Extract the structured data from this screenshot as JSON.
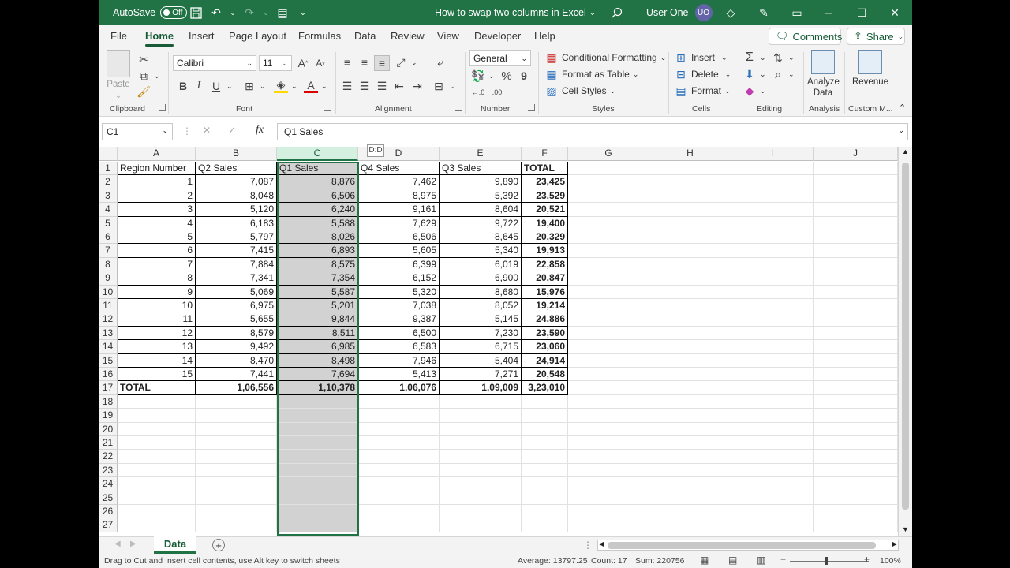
{
  "titlebar": {
    "autosave_label": "AutoSave",
    "autosave_state": "Off",
    "doc_title": "How to swap two columns in Excel",
    "user_name": "User One",
    "user_initials": "UO"
  },
  "tabs": [
    "File",
    "Home",
    "Insert",
    "Page Layout",
    "Formulas",
    "Data",
    "Review",
    "View",
    "Developer",
    "Help"
  ],
  "active_tab": "Home",
  "comments_label": "Comments",
  "share_label": "Share",
  "ribbon": {
    "clipboard": {
      "paste_label": "Paste",
      "group_label": "Clipboard"
    },
    "font": {
      "font_name": "Calibri",
      "font_size": "11",
      "group_label": "Font"
    },
    "alignment": {
      "group_label": "Alignment"
    },
    "number": {
      "format": "General",
      "group_label": "Number",
      "percent": "%",
      "comma": "9",
      "inc_decimal": "←.0\n.00",
      "dec_decimal": ".00\n→.0"
    },
    "styles": {
      "conditional": "Conditional Formatting",
      "format_table": "Format as Table",
      "cell_styles": "Cell Styles",
      "group_label": "Styles"
    },
    "cells": {
      "insert": "Insert",
      "delete": "Delete",
      "format": "Format",
      "group_label": "Cells"
    },
    "editing": {
      "group_label": "Editing"
    },
    "analysis": {
      "button": "Analyze Data",
      "group_label": "Analysis"
    },
    "custom": {
      "button": "Revenue",
      "group_label": "Custom M..."
    }
  },
  "namebox": "C1",
  "formula": "Q1 Sales",
  "drag_tip": "D:D",
  "columns": [
    "A",
    "B",
    "C",
    "D",
    "E",
    "F",
    "G",
    "H",
    "I",
    "J"
  ],
  "selected_column": "C",
  "headers": [
    "Region Number",
    "Q2 Sales",
    "Q1 Sales",
    "Q4 Sales",
    "Q3 Sales",
    "TOTAL"
  ],
  "rows": [
    [
      "1",
      "7,087",
      "8,876",
      "7,462",
      "9,890",
      "23,425"
    ],
    [
      "2",
      "8,048",
      "6,506",
      "8,975",
      "5,392",
      "23,529"
    ],
    [
      "3",
      "5,120",
      "6,240",
      "9,161",
      "8,604",
      "20,521"
    ],
    [
      "4",
      "6,183",
      "5,588",
      "7,629",
      "9,722",
      "19,400"
    ],
    [
      "5",
      "5,797",
      "8,026",
      "6,506",
      "8,645",
      "20,329"
    ],
    [
      "6",
      "7,415",
      "6,893",
      "5,605",
      "5,340",
      "19,913"
    ],
    [
      "7",
      "7,884",
      "8,575",
      "6,399",
      "6,019",
      "22,858"
    ],
    [
      "8",
      "7,341",
      "7,354",
      "6,152",
      "6,900",
      "20,847"
    ],
    [
      "9",
      "5,069",
      "5,587",
      "5,320",
      "8,680",
      "15,976"
    ],
    [
      "10",
      "6,975",
      "5,201",
      "7,038",
      "8,052",
      "19,214"
    ],
    [
      "11",
      "5,655",
      "9,844",
      "9,387",
      "5,145",
      "24,886"
    ],
    [
      "12",
      "8,579",
      "8,511",
      "6,500",
      "7,230",
      "23,590"
    ],
    [
      "13",
      "9,492",
      "6,985",
      "6,583",
      "6,715",
      "23,060"
    ],
    [
      "14",
      "8,470",
      "8,498",
      "7,946",
      "5,404",
      "24,914"
    ],
    [
      "15",
      "7,441",
      "7,694",
      "5,413",
      "7,271",
      "20,548"
    ]
  ],
  "totals": [
    "TOTAL",
    "1,06,556",
    "1,10,378",
    "1,06,076",
    "1,09,009",
    "3,23,010"
  ],
  "row_count": 27,
  "sheet_tab": "Data",
  "status": {
    "message": "Drag to Cut and Insert cell contents, use Alt key to switch sheets",
    "average": "Average: 13797.25",
    "count": "Count: 17",
    "sum": "Sum: 220756",
    "zoom": "100%"
  },
  "colors": {
    "accent": "#217346",
    "selected_fill": "#d2d2d2"
  }
}
